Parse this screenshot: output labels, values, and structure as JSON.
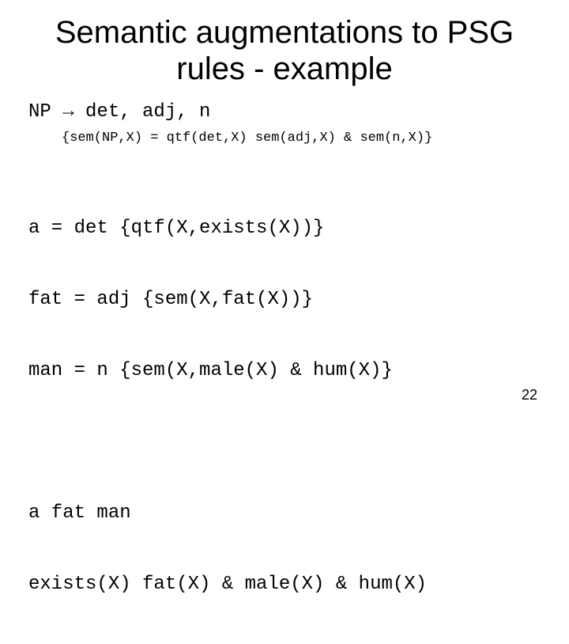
{
  "title": "Semantic augmentations to PSG rules - example",
  "rule_line": "NP → det, adj, n",
  "rule_sem": "{sem(NP,X) = qtf(det,X) sem(adj,X) & sem(n,X)}",
  "lex": {
    "l1": "a = det {qtf(X,exists(X))}",
    "l2": "fat = adj {sem(X,fat(X))}",
    "l3": "man = n {sem(X,male(X) & hum(X)}"
  },
  "example": {
    "e1": "a fat man",
    "e2": "exists(X) fat(X) & male(X) & hum(X)"
  },
  "page_number": "22"
}
